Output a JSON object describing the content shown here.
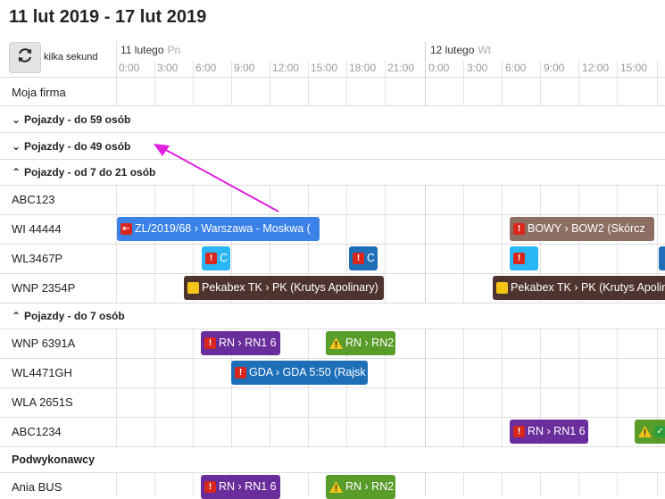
{
  "header": {
    "title": "11 lut 2019 - 17 lut 2019",
    "refresh_label": "kilka sekund"
  },
  "timeline": {
    "days": [
      {
        "label": "11 lutego",
        "weekday": "Pn"
      },
      {
        "label": "12 lutego",
        "weekday": "Wt"
      }
    ],
    "hours_day1": [
      "0:00",
      "3:00",
      "6:00",
      "9:00",
      "12:00",
      "15:00",
      "18:00",
      "21:00"
    ],
    "hours_day2": [
      "0:00",
      "3:00",
      "6:00",
      "9:00",
      "12:00",
      "15:00"
    ]
  },
  "rows": {
    "moja_firma": "Moja firma",
    "group_59": "Pojazdy - do 59 osób",
    "group_49": "Pojazdy - do 49 osób",
    "group_7_21": "Pojazdy - od 7 do 21 osób",
    "abc123": "ABC123",
    "wi44444": "WI 44444",
    "wl3467p": "WL3467P",
    "wnp2354p": "WNP 2354P",
    "group_7": "Pojazdy - do 7 osób",
    "wnp6391a": "WNP 6391A",
    "wl4471gh": "WL4471GH",
    "wla2651s": "WLA 2651S",
    "abc1234": "ABC1234",
    "podwykonawcy": "Podwykonawcy",
    "ania_bus": "Ania BUS"
  },
  "chevrons": {
    "collapsed": "⌄",
    "expanded": "⌃"
  },
  "events": {
    "wi_1": "ZL/2019/68 › Warszawa - Moskwa (",
    "wi_2": "BOWY › BOW2 (Skórcz ",
    "wl_1": "C",
    "wl_2": "C",
    "wnp_1": "Pekabex TK › PK (Krutys Apolinary)",
    "wnp_2": "Pekabex TK › PK (Krutys Apolinary",
    "w6391_1": "RN › RN1 6",
    "w6391_2": "RN › RN2",
    "wl4471_1": "GDA › GDA 5:50 (Rajsk",
    "abc1234_1": "RN › RN1 6",
    "ania_1": "RN › RN1 6",
    "ania_2": "RN › RN2"
  },
  "colors": {
    "blue": "#3b82e8",
    "brown": "#8d6e63",
    "cyan": "#29b6f6",
    "navy": "#1e6fb8",
    "darkbrown": "#4e342e",
    "purple": "#6a2d9c",
    "green": "#5a9c2a",
    "arrow": "#e020e0"
  }
}
